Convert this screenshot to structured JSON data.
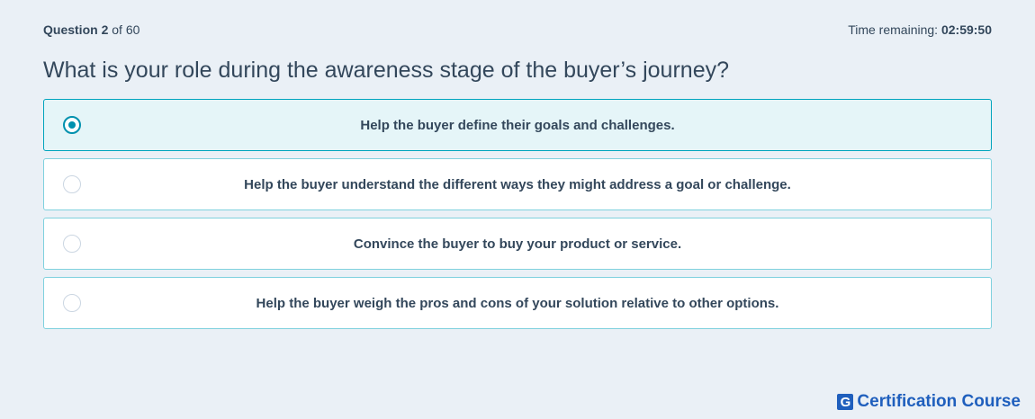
{
  "header": {
    "question_word": "Question",
    "question_number": "2",
    "question_of": "of 60",
    "time_label": "Time remaining:",
    "time_value": "02:59:50"
  },
  "question": {
    "text": "What is your role during the awareness stage of the buyer’s journey?"
  },
  "options": [
    {
      "label": "Help the buyer define their goals and challenges.",
      "selected": true
    },
    {
      "label": "Help the buyer understand the different ways they might address a goal or challenge.",
      "selected": false
    },
    {
      "label": "Convince the buyer to buy your product or service.",
      "selected": false
    },
    {
      "label": "Help the buyer weigh the pros and cons of your solution relative to other options.",
      "selected": false
    }
  ],
  "brand": {
    "logo_letter": "G",
    "name": "Certification Course",
    "color": "#1f5fbd"
  },
  "colors": {
    "accent": "#0091ae",
    "selected_bg": "#e5f5f8",
    "option_border": "#7fd1de",
    "page_bg": "#eaf0f6",
    "text": "#33475b"
  }
}
